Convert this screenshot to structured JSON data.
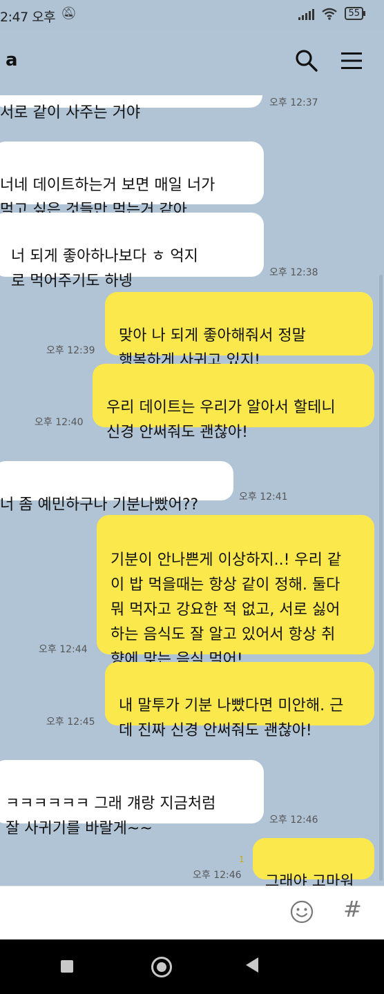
{
  "statusbar": {
    "time": "2:47 오후",
    "battery": "55",
    "mute_icon": "bell-off-icon"
  },
  "header": {
    "title": "a",
    "search_icon": "search-icon",
    "menu_icon": "hamburger-menu-icon"
  },
  "messages": [
    {
      "sender": "other",
      "text": "서로 같이 사주는 거야",
      "time": "오후 12:37"
    },
    {
      "sender": "other",
      "text": "너네 데이트하는거 보면 매일 너가\n먹고 싶은 것들만 먹는거 같아",
      "time": ""
    },
    {
      "sender": "other",
      "text": "너 되게 좋아하나보다 ㅎ 억지\n로 먹어주기도 하넹",
      "time": "오후 12:38"
    },
    {
      "sender": "me",
      "text": "맞아 나 되게 좋아해줘서 정말\n행복하게 사귀고 있지!",
      "time": "오후 12:39"
    },
    {
      "sender": "me",
      "text": "우리 데이트는 우리가 알아서 할테니\n신경 안써줘도 괜찮아!",
      "time": "오후 12:40"
    },
    {
      "sender": "other",
      "text": "너 좀 예민하구나 기분나빴어??",
      "time": "오후 12:41"
    },
    {
      "sender": "me",
      "text": "기분이 안나쁜게 이상하지..! 우리 같\n이 밥 먹을때는 항상 같이 정해. 둘다\n뭐 먹자고 강요한 적 없고, 서로 싫어\n하는 음식도 잘 알고 있어서 항상 취\n향에 맞는 음식 먹어!",
      "time": "오후 12:44"
    },
    {
      "sender": "me",
      "text": "내 말투가 기분 나빴다면 미안해. 근\n데 진짜 신경 안써줘도 괜찮아!",
      "time": "오후 12:45"
    },
    {
      "sender": "other",
      "text": "ㅋㅋㅋㅋㅋㅋ 그래 걔랑 지금처럼\n잘 사귀기를 바랄게~~",
      "time": "오후 12:46"
    },
    {
      "sender": "me",
      "text": "그래야 고마워",
      "time": "오후 12:46",
      "unread": "1"
    }
  ],
  "input": {
    "emoji_icon": "emoji-icon",
    "hash_label": "#"
  },
  "navbar": {
    "back_icon": "square-icon",
    "home_icon": "home-circle-icon",
    "recents_icon": "triangle-back-icon"
  }
}
